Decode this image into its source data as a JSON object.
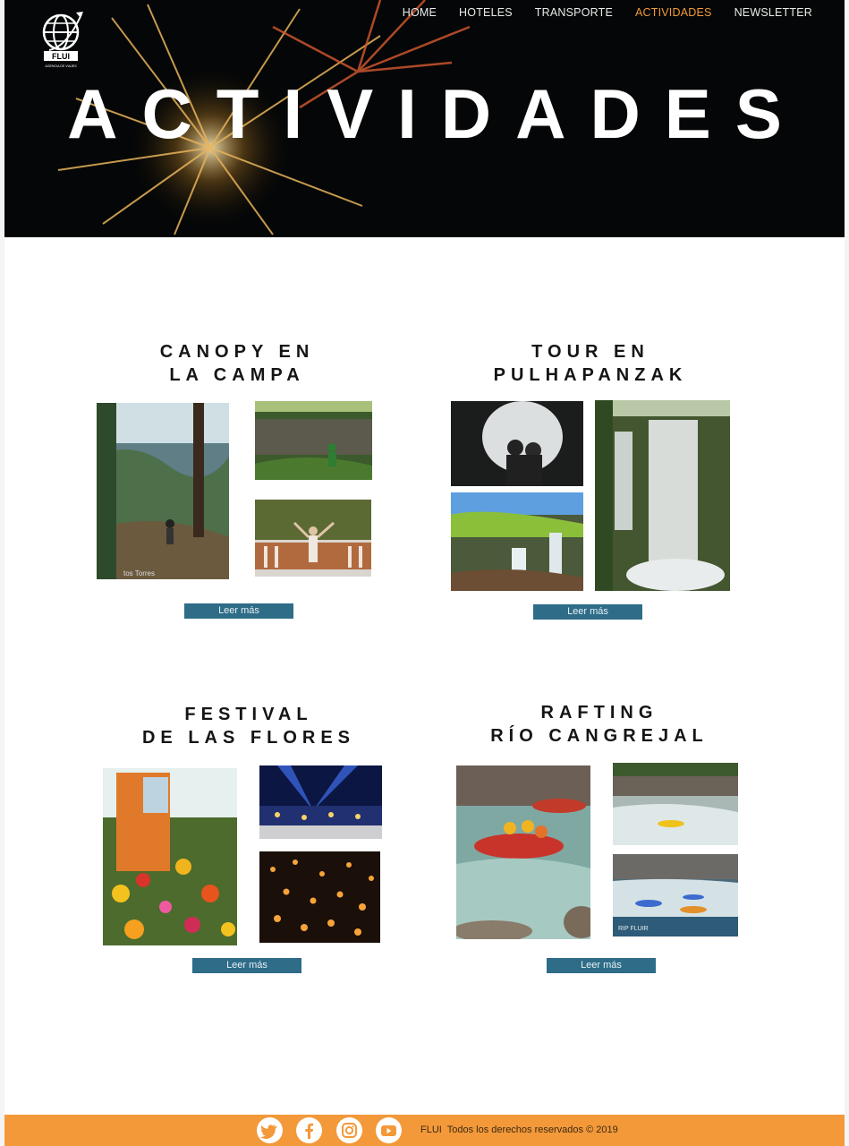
{
  "nav": {
    "items": [
      {
        "label": "HOME"
      },
      {
        "label": "HOTELES"
      },
      {
        "label": "TRANSPORTE"
      },
      {
        "label": "ACTIVIDADES",
        "active": true
      },
      {
        "label": "NEWSLETTER"
      }
    ],
    "active_color": "#f29b38"
  },
  "logo": {
    "text": "FLUI",
    "tagline": "AGENCIA DE VIAJES"
  },
  "hero": {
    "title": "ACTIVIDADES"
  },
  "activities": [
    {
      "title_line1": "CANOPY EN",
      "title_line2": "LA CAMPA",
      "button": "Leer más",
      "photo_caption": "tos Torres"
    },
    {
      "title_line1": "TOUR EN",
      "title_line2": "PULHAPANZAK",
      "button": "Leer más"
    },
    {
      "title_line1": "FESTIVAL",
      "title_line2": "DE LAS FLORES",
      "button": "Leer más"
    },
    {
      "title_line1": "RAFTING",
      "title_line2": "RÍO CANGREJAL",
      "button": "Leer más",
      "photo_caption": "RIP FLUIR"
    }
  ],
  "footer": {
    "social": [
      "twitter-icon",
      "facebook-icon",
      "instagram-icon",
      "youtube-icon"
    ],
    "brand": "FLUI",
    "copyright": "Todos los derechos reservados © 2019",
    "background": "#f3993a"
  },
  "colors": {
    "button": "#2e6c88",
    "hero_bg": "#040607"
  }
}
